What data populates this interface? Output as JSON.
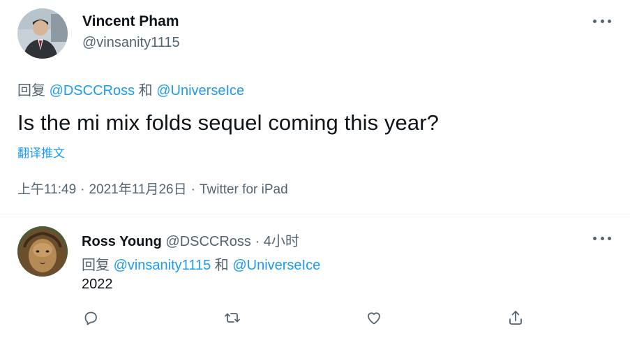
{
  "main_tweet": {
    "author_name": "Vincent Pham",
    "author_handle": "@vinsanity1115",
    "reply_prefix": "回复",
    "reply_mention_1": "@DSCCRoss",
    "reply_conj": "和",
    "reply_mention_2": "@UniverseIce",
    "text": "Is the mi mix folds sequel coming this year?",
    "translate_label": "翻译推文",
    "time": "上午11:49",
    "date": "2021年11月26日",
    "source": "Twitter for iPad",
    "separator": "·"
  },
  "reply_tweet": {
    "author_name": "Ross Young",
    "author_handle": "@DSCCRoss",
    "separator": "·",
    "time_ago": "4小时",
    "reply_prefix": "回复",
    "reply_mention_1": "@vinsanity1115",
    "reply_conj": "和",
    "reply_mention_2": "@UniverseIce",
    "text": "2022"
  },
  "icons": {
    "more": "more-horizontal-icon",
    "reply": "reply-bubble-icon",
    "retweet": "retweet-icon",
    "like": "heart-icon",
    "share": "share-icon"
  },
  "colors": {
    "accent": "#1d9bf0",
    "secondary_text": "#536471",
    "primary_text": "#0f1419",
    "divider": "#eff3f4"
  }
}
